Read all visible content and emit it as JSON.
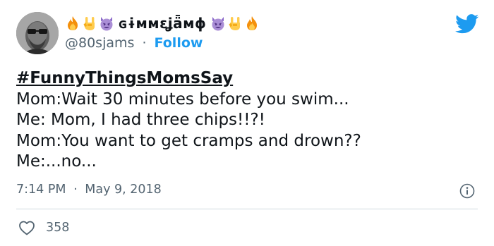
{
  "author": {
    "display_name": "ɢɨммɛʝǟмɸ",
    "handle": "@80sjams",
    "separator": "·",
    "follow_label": "Follow",
    "emojis_before": [
      "fire-emoji",
      "rock-hand-emoji",
      "smiling-devil-emoji"
    ],
    "emojis_after": [
      "smiling-devil-emoji",
      "rock-hand-emoji",
      "fire-emoji"
    ]
  },
  "tweet": {
    "hashtag": "#FunnyThingsMomsSay",
    "lines": [
      "Mom:Wait 30 minutes before you swim...",
      "Me: Mom, I had three chips!!?!",
      "Mom:You want to get cramps and drown??",
      "Me:...no..."
    ]
  },
  "meta": {
    "time": "7:14 PM",
    "separator": "·",
    "date": "May 9, 2018"
  },
  "engagement": {
    "likes": "358"
  },
  "colors": {
    "link_blue": "#1d9bf0",
    "text": "#0f1419",
    "secondary": "#536471",
    "divider": "#cfd9de"
  }
}
